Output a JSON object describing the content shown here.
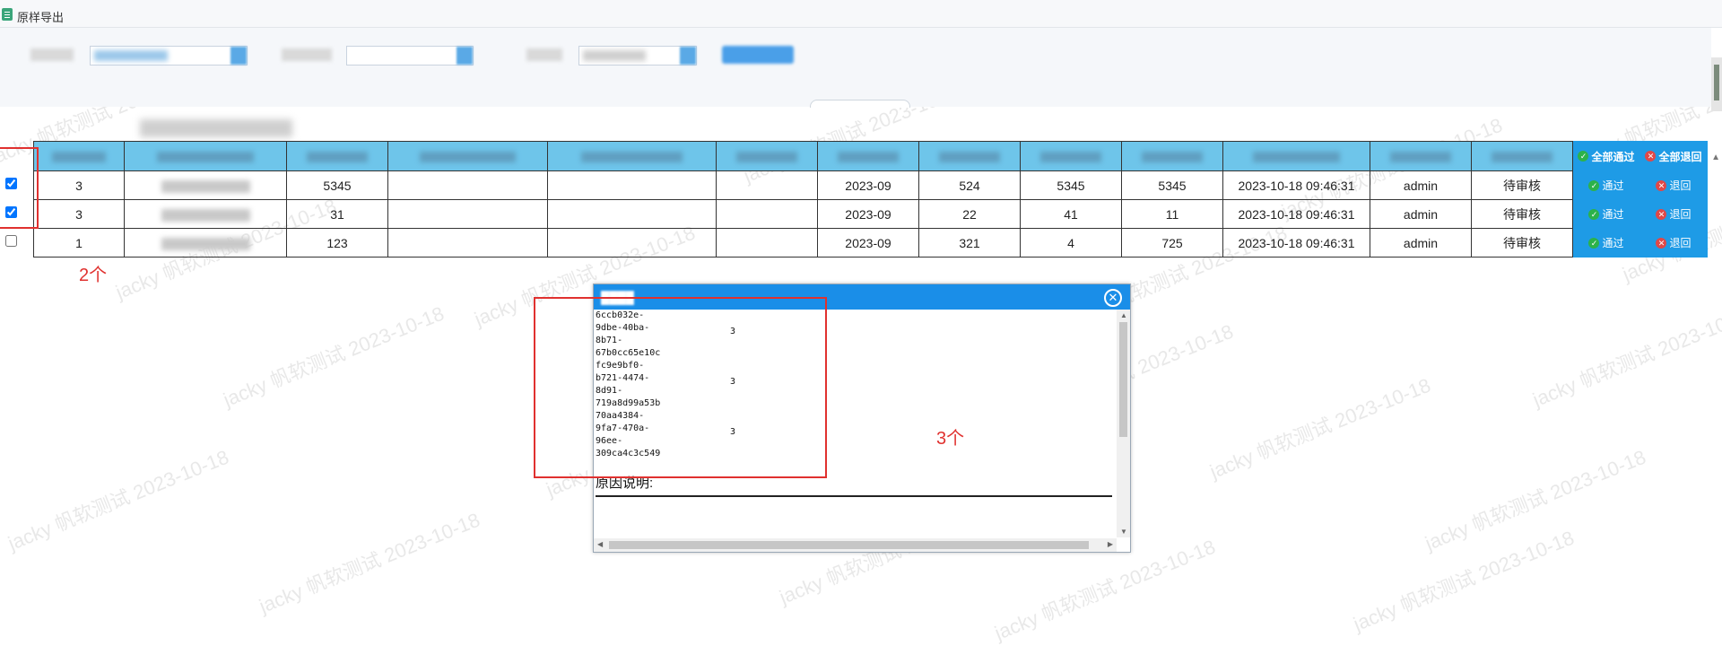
{
  "app": {
    "title": "原样导出"
  },
  "watermark": "jacky 帆软测试 2023-10-18",
  "table": {
    "header_actions": {
      "approve_all": "全部通过",
      "return_all": "全部退回"
    },
    "rows": [
      {
        "checked": true,
        "c1": "3",
        "c3": "5345",
        "c7": "2023-09",
        "c8": "524",
        "c9": "5345",
        "c10": "5345",
        "time": "2023-10-18 09:46:31",
        "user": "admin",
        "status": "待审核",
        "approve": "通过",
        "return": "退回"
      },
      {
        "checked": true,
        "c1": "3",
        "c3": "31",
        "c7": "2023-09",
        "c8": "22",
        "c9": "41",
        "c10": "11",
        "time": "2023-10-18 09:46:31",
        "user": "admin",
        "status": "待审核",
        "approve": "通过",
        "return": "退回"
      },
      {
        "checked": false,
        "c1": "1",
        "c3": "123",
        "c7": "2023-09",
        "c8": "321",
        "c9": "4",
        "c10": "725",
        "time": "2023-10-18 09:46:31",
        "user": "admin",
        "status": "待审核",
        "approve": "通过",
        "return": "退回"
      }
    ]
  },
  "annotations": {
    "selected_count": "2个",
    "dialog_count": "3个"
  },
  "dialog": {
    "ids": [
      {
        "id": "6ccb032e-\n9dbe-40ba-\n8b71-\n67b0cc65e10c",
        "count": "3"
      },
      {
        "id": "fc9e9bf0-\nb721-4474-\n8d91-\n719a8d99a53b",
        "count": "3"
      },
      {
        "id": "70aa4384-\n9fa7-470a-\n96ee-\n309ca4c3c549",
        "count": "3"
      }
    ],
    "reason_label": "原因说明:",
    "close_icon": "close-circle-icon"
  }
}
